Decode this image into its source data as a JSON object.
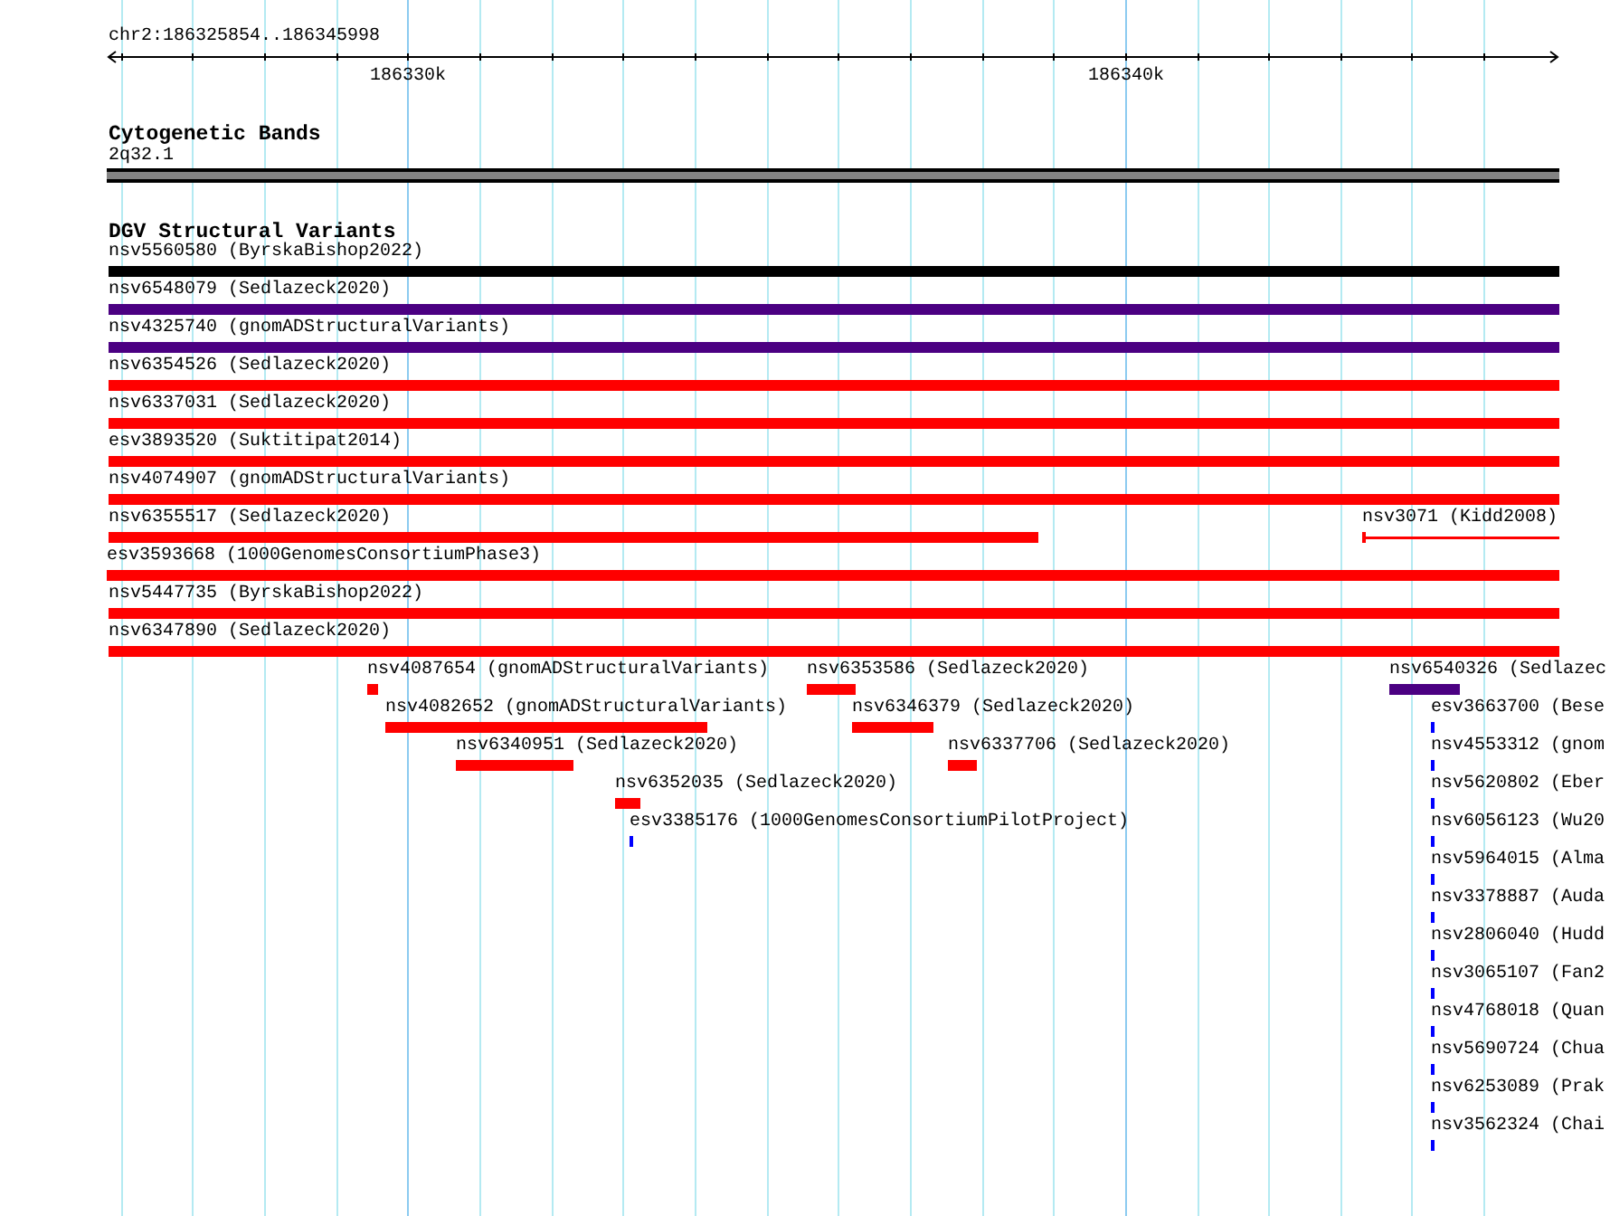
{
  "ruler": {
    "region": "chr2:186325854..186345998",
    "tick_labels": [
      "186330k",
      "186340k"
    ]
  },
  "cytogenetic_bands": {
    "title": "Cytogenetic Bands",
    "band": {
      "label": "2q32.1"
    }
  },
  "structural_variants": {
    "title": "DGV Structural Variants",
    "features": [
      {
        "label": "nsv5560580 (ByrskaBishop2022)",
        "kind": "box",
        "color": "#000000"
      },
      {
        "label": "nsv6548079 (Sedlazeck2020)",
        "kind": "box",
        "color": "#4b0082"
      },
      {
        "label": "nsv4325740 (gnomADStructuralVariants)",
        "kind": "box",
        "color": "#4b0082"
      },
      {
        "label": "nsv6354526 (Sedlazeck2020)",
        "kind": "box",
        "color": "#ff0000"
      },
      {
        "label": "nsv6337031 (Sedlazeck2020)",
        "kind": "box",
        "color": "#ff0000"
      },
      {
        "label": "esv3893520 (Suktitipat2014)",
        "kind": "box",
        "color": "#ff0000"
      },
      {
        "label": "nsv4074907 (gnomADStructuralVariants)",
        "kind": "box",
        "color": "#ff0000"
      },
      {
        "label": "nsv6355517 (Sedlazeck2020)",
        "kind": "box",
        "color": "#ff0000"
      },
      {
        "label": "nsv3071 (Kidd2008)",
        "kind": "line",
        "color": "#ff0000"
      },
      {
        "label": "esv3593668 (1000GenomesConsortiumPhase3)",
        "kind": "box",
        "color": "#ff0000"
      },
      {
        "label": "nsv5447735 (ByrskaBishop2022)",
        "kind": "box",
        "color": "#ff0000"
      },
      {
        "label": "nsv6347890 (Sedlazeck2020)",
        "kind": "box",
        "color": "#ff0000"
      },
      {
        "label": "nsv4087654 (gnomADStructuralVariants)",
        "kind": "box",
        "color": "#ff0000"
      },
      {
        "label": "nsv6353586 (Sedlazeck2020)",
        "kind": "box",
        "color": "#ff0000"
      },
      {
        "label": "nsv6540326 (Sedlazec",
        "kind": "box",
        "color": "#4b0082"
      },
      {
        "label": "nsv4082652 (gnomADStructuralVariants)",
        "kind": "box",
        "color": "#ff0000"
      },
      {
        "label": "nsv6346379 (Sedlazeck2020)",
        "kind": "box",
        "color": "#ff0000"
      },
      {
        "label": "esv3663700 (Bese",
        "kind": "box",
        "color": "#0000ff"
      },
      {
        "label": "nsv6340951 (Sedlazeck2020)",
        "kind": "box",
        "color": "#ff0000"
      },
      {
        "label": "nsv6337706 (Sedlazeck2020)",
        "kind": "box",
        "color": "#ff0000"
      },
      {
        "label": "nsv4553312 (gnom",
        "kind": "box",
        "color": "#0000ff"
      },
      {
        "label": "nsv6352035 (Sedlazeck2020)",
        "kind": "box",
        "color": "#ff0000"
      },
      {
        "label": "nsv5620802 (Eber",
        "kind": "box",
        "color": "#0000ff"
      },
      {
        "label": "esv3385176 (1000GenomesConsortiumPilotProject)",
        "kind": "box",
        "color": "#0000ff"
      },
      {
        "label": "nsv6056123 (Wu20",
        "kind": "box",
        "color": "#0000ff"
      },
      {
        "label": "nsv5964015 (Alma",
        "kind": "box",
        "color": "#0000ff"
      },
      {
        "label": "nsv3378887 (Auda",
        "kind": "box",
        "color": "#0000ff"
      },
      {
        "label": "nsv2806040 (Hudd",
        "kind": "box",
        "color": "#0000ff"
      },
      {
        "label": "nsv3065107 (Fan2",
        "kind": "box",
        "color": "#0000ff"
      },
      {
        "label": "nsv4768018 (Quan",
        "kind": "box",
        "color": "#0000ff"
      },
      {
        "label": "nsv5690724 (Chua",
        "kind": "box",
        "color": "#0000ff"
      },
      {
        "label": "nsv6253089 (Prak",
        "kind": "box",
        "color": "#0000ff"
      },
      {
        "label": "nsv3562324 (Chai",
        "kind": "box",
        "color": "#0000ff"
      }
    ]
  }
}
